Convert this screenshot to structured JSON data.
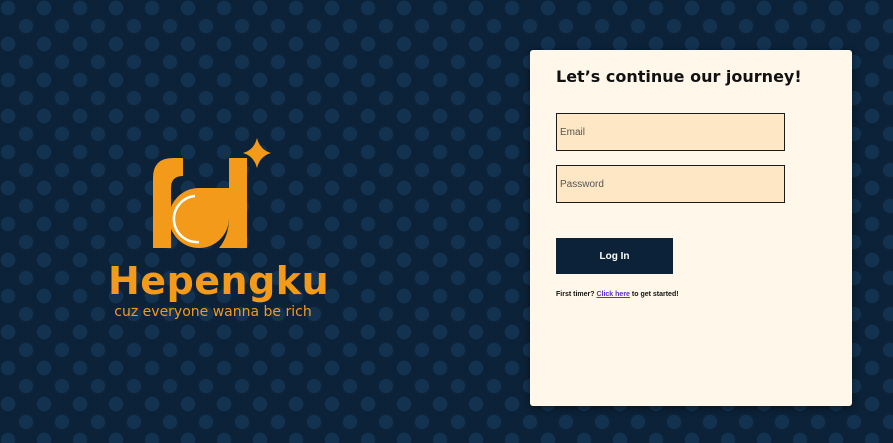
{
  "brand": {
    "name": "Hepengku",
    "tagline": "cuz everyone wanna be rich",
    "color": "#f39a1a"
  },
  "login_card": {
    "title": "Let’s continue our journey!",
    "email": {
      "value": "",
      "placeholder": "Email"
    },
    "password": {
      "value": "",
      "placeholder": "Password"
    },
    "login_button": "Log In",
    "signup_prefix": "First timer?",
    "signup_link": "Click here",
    "signup_suffix": "to get started!"
  },
  "colors": {
    "background": "#0c2238",
    "card": "#fff7ea",
    "input": "#fde7c4",
    "button": "#0c2238",
    "link": "#5b2fd0"
  },
  "icons": [
    "hepengku-logo-icon",
    "sparkle-icon"
  ]
}
